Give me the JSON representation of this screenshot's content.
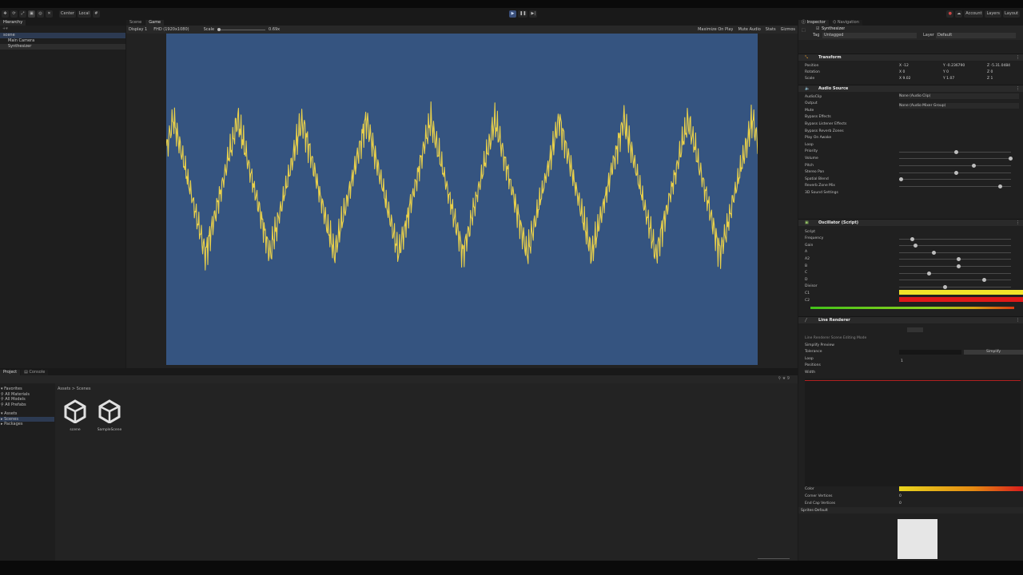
{
  "toolbar": {
    "buttons": [
      "Center",
      "Local"
    ],
    "play_icon": "play-icon",
    "pause_icon": "pause-icon",
    "step_icon": "step-icon",
    "account": "Account",
    "layers": "Layers",
    "layout": "Layout"
  },
  "hierarchy": {
    "tab": "Hierarchy",
    "items": [
      "scene",
      "Main Camera",
      "Synthesizer"
    ]
  },
  "scene_tabs": [
    "Scene",
    "Game"
  ],
  "gamebar": {
    "display": "Display 1",
    "resolution": "FHD (1920x1080)",
    "scale_label": "Scale",
    "scale_value": "0.69x",
    "maximize": "Maximize On Play",
    "mute": "Mute Audio",
    "stats": "Stats",
    "gizmos": "Gizmos"
  },
  "project": {
    "tabs": [
      "Project",
      "Console"
    ],
    "breadcrumb": "Assets > Scenes",
    "favorites": "Favorites",
    "fav_items": [
      "All Materials",
      "All Models",
      "All Prefabs"
    ],
    "assets": "Assets",
    "asset_items": [
      "Scenes",
      "Packages"
    ],
    "files": [
      "scene",
      "SampleScene"
    ]
  },
  "inspector": {
    "tabs": [
      "Inspector",
      "Navigation"
    ],
    "object_name": "Synthesizer",
    "tag_label": "Tag",
    "tag": "Untagged",
    "layer_label": "Layer",
    "layer": "Default",
    "transform": {
      "title": "Transform",
      "position": "Position",
      "rotation": "Rotation",
      "scale": "Scale",
      "px": "X -12",
      "py": "Y -0.236790",
      "pz": "Z -5.31.0484",
      "rx": "X 0",
      "ry": "Y 0",
      "rz": "Z 0",
      "sx": "X 9.02",
      "sy": "Y 1.07",
      "sz": "Z 1"
    },
    "audio": {
      "title": "Audio Source",
      "fields": [
        "AudioClip",
        "Output",
        "Mute",
        "Bypass Effects",
        "Bypass Listener Effects",
        "Bypass Reverb Zones",
        "Play On Awake",
        "Loop",
        "Priority",
        "Volume",
        "Pitch",
        "Stereo Pan",
        "Spatial Blend",
        "Reverb Zone Mix",
        "3D Sound Settings"
      ],
      "clip": "None (Audio Clip)",
      "output": "None (Audio Mixer Group)"
    },
    "osc": {
      "title": "Oscillator (Script)",
      "script": "Oscillator",
      "fields": [
        "Script",
        "Frequency",
        "Gain",
        "A",
        "A2",
        "B",
        "C",
        "D",
        "Divisor",
        "C1",
        "C2"
      ]
    },
    "line": {
      "title": "Line Renderer",
      "scene_tools": "Line Renderer Scene Editing Mode",
      "fields": [
        "Simplify Preview",
        "Tolerance",
        "Loop",
        "Positions",
        "Width"
      ],
      "simplify": "Simplify",
      "tolerance": "1",
      "color": "Color",
      "corner": "Corner Vertices",
      "endcap": "End Cap Vertices",
      "zero": "0",
      "material": "Sprites-Default"
    }
  },
  "colors": {
    "wave": "#e9d04a",
    "view_bg": "#355480"
  }
}
